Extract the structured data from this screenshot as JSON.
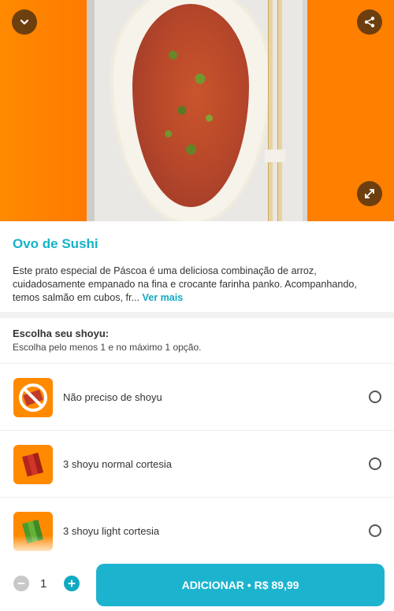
{
  "product": {
    "title": "Ovo de Sushi",
    "description": "Este prato especial de Páscoa é uma deliciosa combinação de arroz, cuidadosamente empanado na fina e crocante farinha panko. Acompanhando, temos salmão em cubos, fr...",
    "see_more": "Ver mais"
  },
  "hero_controls": {
    "collapse_icon": "chevron-down-icon",
    "share_icon": "share-icon",
    "expand_icon": "expand-icon"
  },
  "options_group": {
    "title": "Escolha seu shoyu:",
    "subtitle": "Escolha pelo menos 1 e no máximo 1 opção.",
    "items": [
      {
        "label": "Não preciso de shoyu",
        "icon": "no-shoyu-icon",
        "selected": false
      },
      {
        "label": "3 shoyu normal cortesia",
        "icon": "shoyu-normal-icon",
        "selected": false
      },
      {
        "label": "3 shoyu light cortesia",
        "icon": "shoyu-light-icon",
        "selected": false
      }
    ]
  },
  "footer": {
    "quantity": "1",
    "add_label": "ADICIONAR • R$ 89,99"
  },
  "colors": {
    "accent": "#1cb3cf",
    "title": "#15b3c9",
    "hero_background": "#ff7f00"
  }
}
